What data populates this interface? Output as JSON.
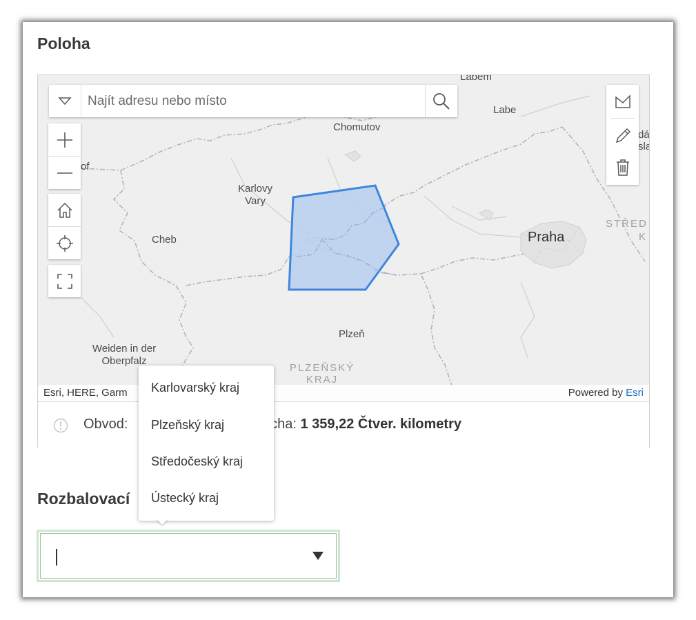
{
  "location": {
    "title": "Poloha",
    "search": {
      "placeholder": "Najít adresu nebo místo"
    },
    "map_labels": {
      "labem": "Labem",
      "labe": "Labe",
      "chomutov": "Chomutov",
      "karlovy_vary_1": "Karlovy",
      "karlovy_vary_2": "Vary",
      "cheb": "Cheb",
      "praha": "Praha",
      "stred_1": "STŘED",
      "stred_2": "K",
      "plzen": "Plzeň",
      "weiden_1": "Weiden in der",
      "weiden_2": "Oberpfalz",
      "plzensky_1": "PLZEŇSKÝ",
      "plzensky_2": "KRAJ",
      "partial_of": "of",
      "partial_da": "dá",
      "partial_sla": "sla"
    },
    "attribution_left": "Esri, HERE, Garm",
    "attribution_right_prefix": "Powered by",
    "attribution_right_link": "Esri",
    "status": {
      "obvod_label": "Obvod:",
      "plocha_label": "ocha:",
      "plocha_value": "1 359,22 Čtver. kilometry"
    },
    "colors": {
      "polygon_fill": "#b7cfee",
      "polygon_stroke": "#3d86de",
      "border_line": "#b4b4b4"
    }
  },
  "dropdown": {
    "label": "Rozbalovací",
    "value": "",
    "options": [
      "Karlovarský kraj",
      "Plzeňský kraj",
      "Středočeský kraj",
      "Ústecký kraj"
    ]
  },
  "icons": {
    "search_dropdown": "chevron-down-icon",
    "search": "search-icon",
    "zoom_in": "plus-icon",
    "zoom_out": "minus-icon",
    "home": "home-icon",
    "locate": "locate-icon",
    "fullscreen": "fullscreen-icon",
    "polygon_tool": "polygon-icon",
    "edit": "pencil-icon",
    "delete": "trash-icon",
    "status": "info-icon"
  }
}
